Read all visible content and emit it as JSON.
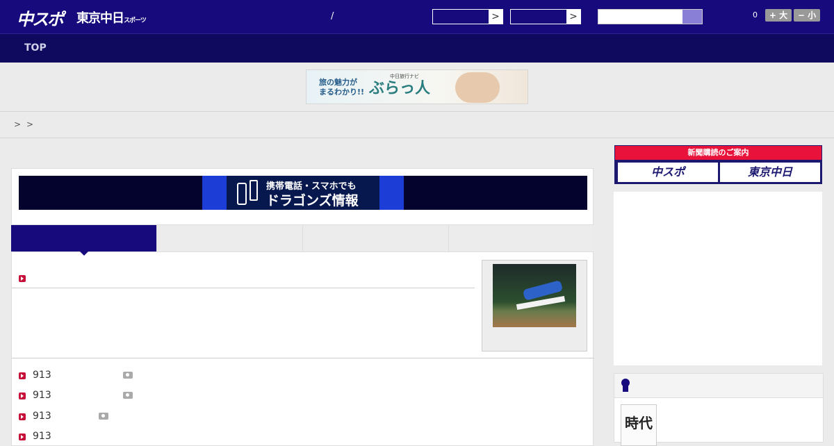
{
  "header": {
    "logo": "中スポ",
    "logo2": "東京中日",
    "logo2_suffix": "スポーツ",
    "separator": "/",
    "select_arrow": ">",
    "count": "0",
    "font_up": "+ 大",
    "font_down": "− 小"
  },
  "nav": {
    "top": "TOP"
  },
  "banner_ad": {
    "line1": "旅の魅力が",
    "line2": "まるわかり!!",
    "brand_small": "中日旅行ナビ",
    "brand": "ぶらっ人"
  },
  "breadcrumb": {
    "sep1": ">",
    "sep2": ">"
  },
  "mobile_ad": {
    "line1": "携帯電話・スマホでも",
    "line2": "ドラゴンズ情報"
  },
  "news_list": [
    {
      "num": "913"
    },
    {
      "num": "913"
    },
    {
      "num": "913"
    },
    {
      "num": "913"
    }
  ],
  "subscription": {
    "header": "新聞購読のご案内",
    "btn1": "中スポ",
    "btn2": "東京中日"
  },
  "ranking": {
    "book_text": "時代"
  },
  "colors": {
    "brand_navy": "#160a7c",
    "accent_red": "#e8123a"
  }
}
